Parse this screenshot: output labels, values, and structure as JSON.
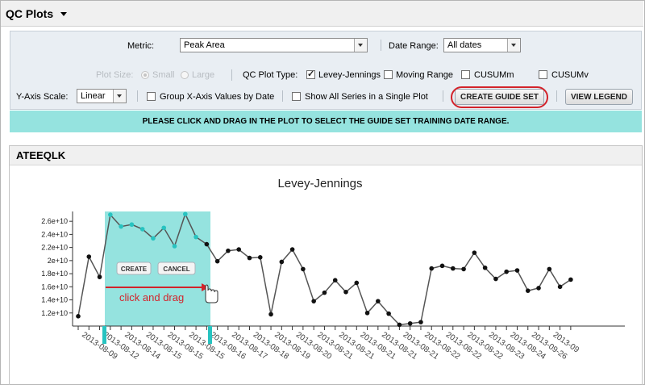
{
  "header": {
    "title": "QC Plots"
  },
  "controls": {
    "metric_label": "Metric:",
    "metric_value": "Peak Area",
    "date_range_label": "Date Range:",
    "date_range_value": "All dates",
    "plot_size_label": "Plot Size:",
    "plot_size_small": "Small",
    "plot_size_large": "Large",
    "qc_plot_type_label": "QC Plot Type:",
    "levey_jennings": "Levey-Jennings",
    "moving_range": "Moving Range",
    "cusum_m": "CUSUMm",
    "cusum_v": "CUSUMv",
    "y_axis_scale_label": "Y-Axis Scale:",
    "y_axis_scale_value": "Linear",
    "group_x_axis": "Group X-Axis Values by Date",
    "show_all_series": "Show All Series in a Single Plot",
    "create_guide_set": "CREATE GUIDE SET",
    "view_legend": "VIEW LEGEND"
  },
  "banner": {
    "text": "PLEASE CLICK AND DRAG IN THE PLOT TO SELECT THE GUIDE SET TRAINING DATE RANGE."
  },
  "panel": {
    "title": "ATEEQLK"
  },
  "selection": {
    "create_label": "CREATE",
    "cancel_label": "CANCEL",
    "hint": "click and drag"
  },
  "colors": {
    "accent_teal": "#95e3df",
    "highlight_red": "#d3232a",
    "point_selected": "#27c3c0",
    "line": "#555555"
  },
  "chart_data": {
    "type": "line",
    "title": "Levey-Jennings",
    "ylim": [
      10000000000.0,
      27500000000.0
    ],
    "yticks": [
      "1.2e+10",
      "1.4e+10",
      "1.6e+10",
      "1.8e+10",
      "2e+10",
      "2.2e+10",
      "2.4e+10",
      "2.6e+10"
    ],
    "ytick_values": [
      12000000000.0,
      14000000000.0,
      16000000000.0,
      18000000000.0,
      20000000000.0,
      22000000000.0,
      24000000000.0,
      26000000000.0
    ],
    "xtick_labels": [
      "2013-08-09",
      "2013-08-12",
      "2013-08-14",
      "2013-08-15",
      "2013-08-15",
      "2013-08-15",
      "2013-08-16",
      "2013-08-17",
      "2013-08-18",
      "2013-08-19",
      "2013-08-20",
      "2013-08-21",
      "2013-08-21",
      "2013-08-21",
      "2013-08-21",
      "2013-08-21",
      "2013-08-22",
      "2013-08-22",
      "2013-08-22",
      "2013-08-23",
      "2013-08-24",
      "2013-09-26",
      "2013-09"
    ],
    "series": [
      {
        "values": [
          11500000000.0,
          20600000000.0,
          17500000000.0,
          27000000000.0,
          25200000000.0,
          25500000000.0,
          24800000000.0,
          23400000000.0,
          25000000000.0,
          22200000000.0,
          27100000000.0,
          23600000000.0,
          22500000000.0,
          19900000000.0,
          21500000000.0,
          21700000000.0,
          20400000000.0,
          20500000000.0,
          11800000000.0,
          19800000000.0,
          21700000000.0,
          18700000000.0,
          13800000000.0,
          15100000000.0,
          17000000000.0,
          15200000000.0,
          16600000000.0,
          12000000000.0,
          13800000000.0,
          11900000000.0,
          10200000000.0,
          10400000000.0,
          10600000000.0,
          18800000000.0,
          19200000000.0,
          18800000000.0,
          18700000000.0,
          21200000000.0,
          18900000000.0,
          17200000000.0,
          18300000000.0,
          18500000000.0,
          15400000000.0,
          15800000000.0,
          18700000000.0,
          16000000000.0,
          17100000000.0
        ]
      }
    ],
    "selected_range": [
      3,
      11
    ]
  }
}
